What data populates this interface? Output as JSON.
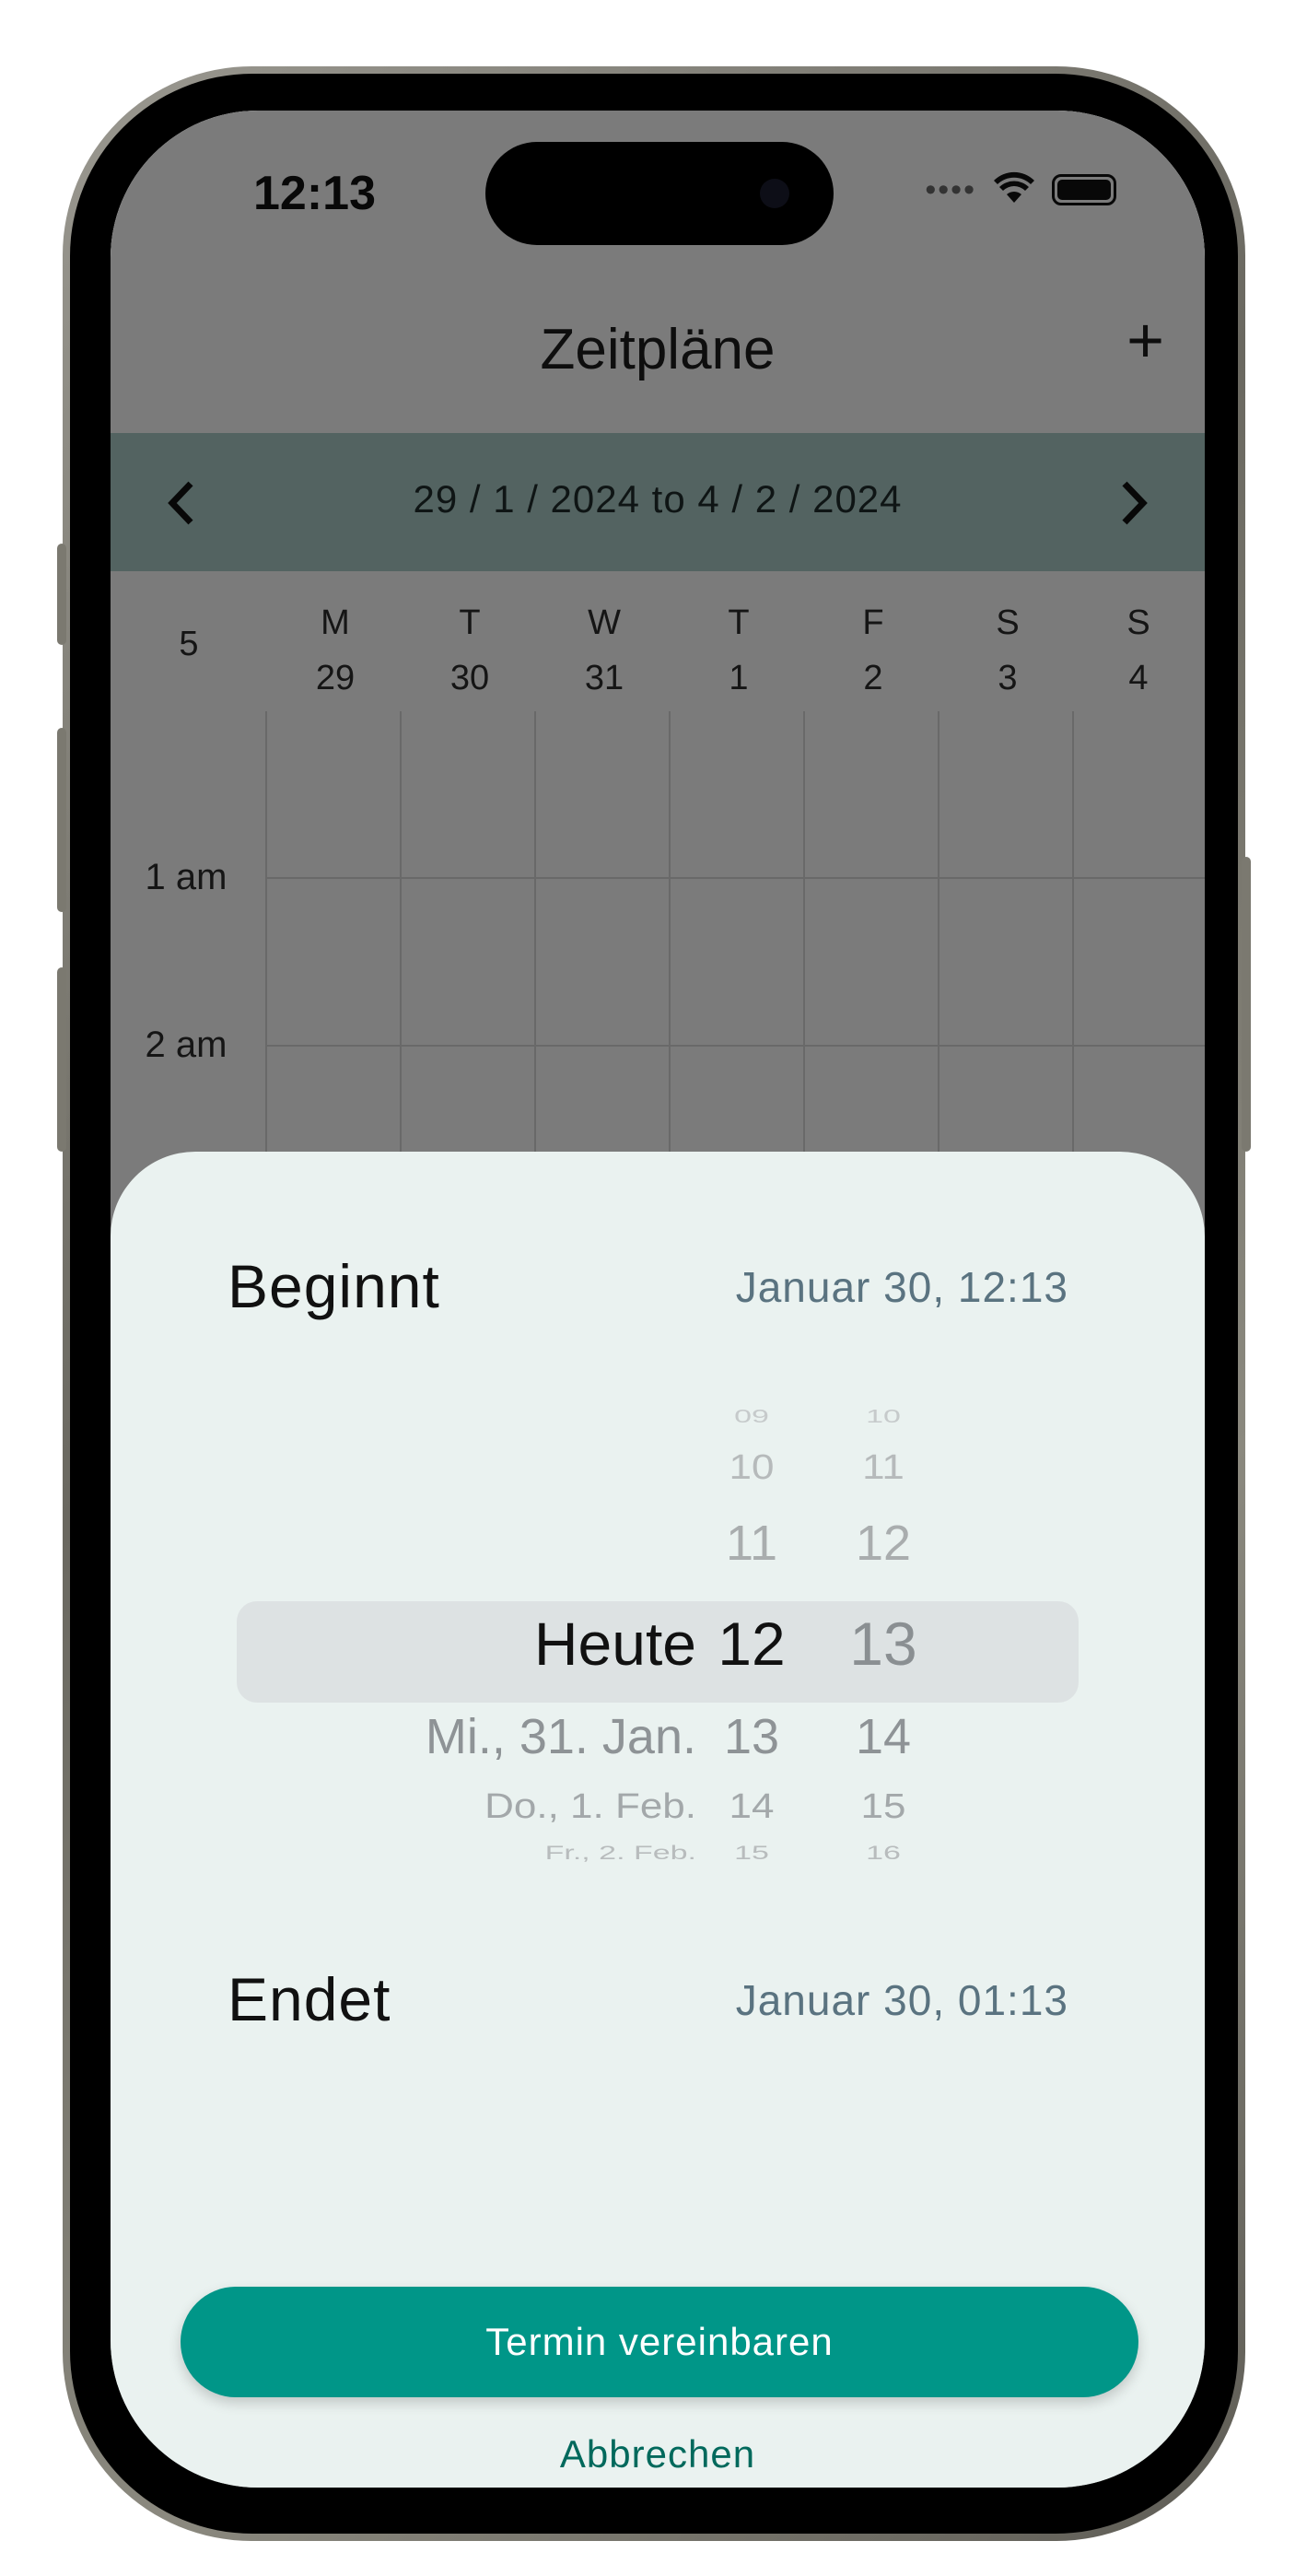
{
  "status_bar": {
    "time": "12:13",
    "signal": "••••"
  },
  "header": {
    "title": "Zeitpläne",
    "add_icon": "plus-icon"
  },
  "date_nav": {
    "range": "29 / 1 / 2024 to 4 / 2 / 2024",
    "prev_icon": "chevron-left-icon",
    "next_icon": "chevron-right-icon"
  },
  "week": {
    "number": "5",
    "days": [
      {
        "letter": "M",
        "date": "29"
      },
      {
        "letter": "T",
        "date": "30"
      },
      {
        "letter": "W",
        "date": "31"
      },
      {
        "letter": "T",
        "date": "1"
      },
      {
        "letter": "F",
        "date": "2"
      },
      {
        "letter": "S",
        "date": "3"
      },
      {
        "letter": "S",
        "date": "4"
      }
    ]
  },
  "hours": [
    "1 am",
    "2 am"
  ],
  "sheet": {
    "start_label": "Beginnt",
    "start_value": "Januar 30, 12:13",
    "end_label": "Endet",
    "end_value": "Januar 30, 01:13",
    "picker": {
      "dates": [
        "Heute",
        "Mi., 31. Jan.",
        "Do., 1. Feb.",
        "Fr., 2. Feb."
      ],
      "hours": [
        "09",
        "10",
        "11",
        "12",
        "13",
        "14",
        "15"
      ],
      "minutes": [
        "10",
        "11",
        "12",
        "13",
        "14",
        "15",
        "16"
      ]
    },
    "confirm_button": "Termin vereinbaren",
    "cancel_button": "Abbrechen"
  },
  "colors": {
    "accent": "#009688",
    "date_bar": "#a6c7c2",
    "sheet_bg": "#eaf2f0",
    "value_text": "#5a7380"
  }
}
